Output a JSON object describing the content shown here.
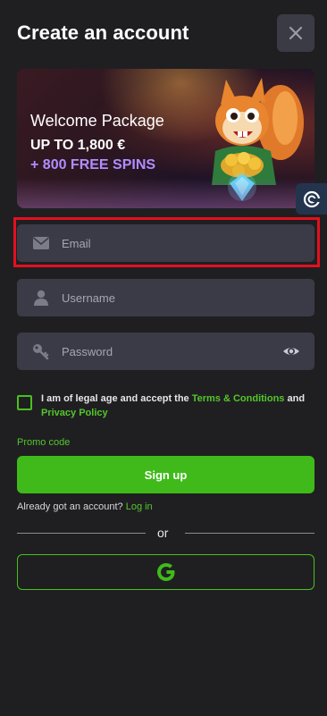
{
  "header": {
    "title": "Create an account",
    "close_icon": "close-icon"
  },
  "banner": {
    "line1": "Welcome Package",
    "line2": "UP TO 1,800 €",
    "line3": "+ 800 FREE SPINS",
    "accent_color": "#b28cff",
    "image": "squirrel-mascot-with-coins-and-diamond"
  },
  "floating_badge_icon": "support-chat-icon",
  "form": {
    "email_placeholder": "Email",
    "username_placeholder": "Username",
    "password_placeholder": "Password",
    "email_icon": "envelope-icon",
    "username_icon": "user-icon",
    "password_icon": "key-icon",
    "show_password_icon": "eye-icon"
  },
  "terms": {
    "prefix": "I am of legal age and accept the ",
    "terms_link": "Terms & Conditions",
    "middle": " and ",
    "privacy_link": "Privacy Policy",
    "checked": false
  },
  "promo_code_label": "Promo code",
  "signup_label": "Sign up",
  "login": {
    "prompt": "Already got an account? ",
    "link": "Log in"
  },
  "divider_text": "or",
  "google_icon": "google-icon",
  "colors": {
    "background": "#1f1f22",
    "field": "#3b3b47",
    "accent_green": "#3fba1a",
    "highlight_red": "#e3101e"
  }
}
